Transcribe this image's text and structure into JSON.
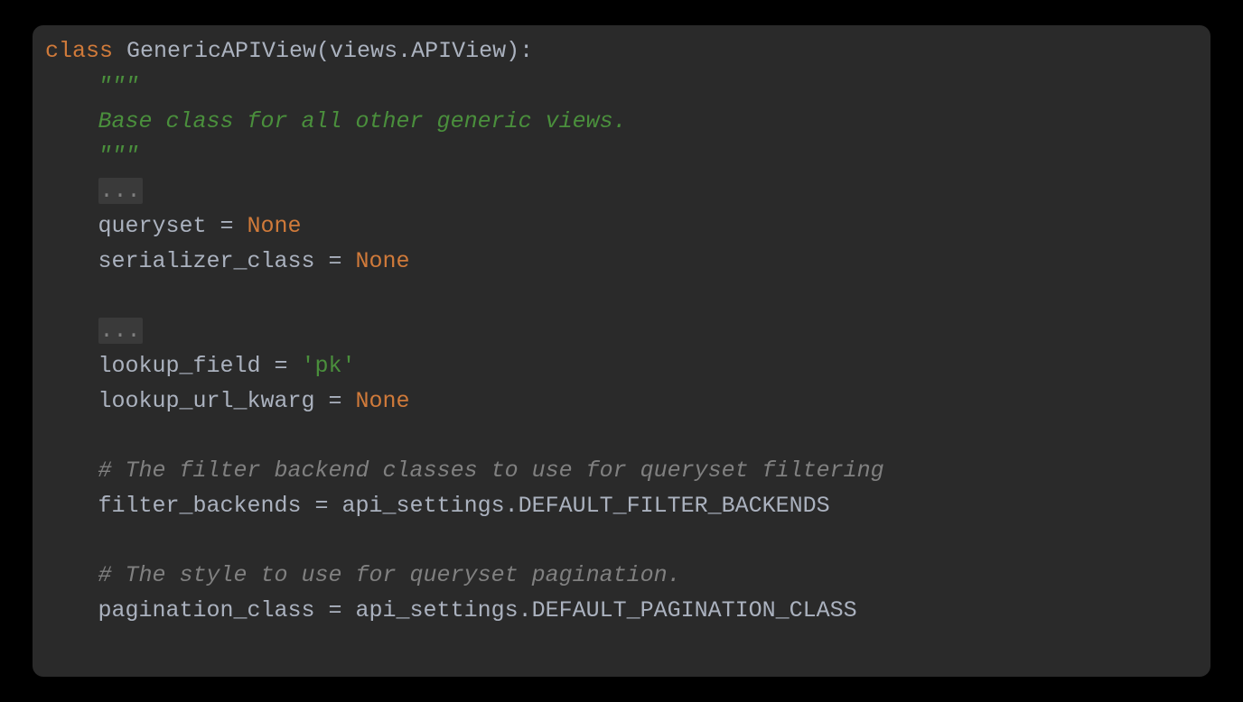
{
  "code": {
    "line1": {
      "keyword": "class",
      "rest": " GenericAPIView(views.APIView):"
    },
    "line2": "\"\"\"",
    "line3": "Base class for all other generic views.",
    "line4": "\"\"\"",
    "fold1": "...",
    "line6a": "queryset = ",
    "line6b": "None",
    "line7a": "serializer_class = ",
    "line7b": "None",
    "fold2": "...",
    "line10a": "lookup_field = ",
    "line10b": "'pk'",
    "line11a": "lookup_url_kwarg = ",
    "line11b": "None",
    "line13": "# The filter backend classes to use for queryset filtering",
    "line14": "filter_backends = api_settings.DEFAULT_FILTER_BACKENDS",
    "line16": "# The style to use for queryset pagination.",
    "line17": "pagination_class = api_settings.DEFAULT_PAGINATION_CLASS"
  }
}
